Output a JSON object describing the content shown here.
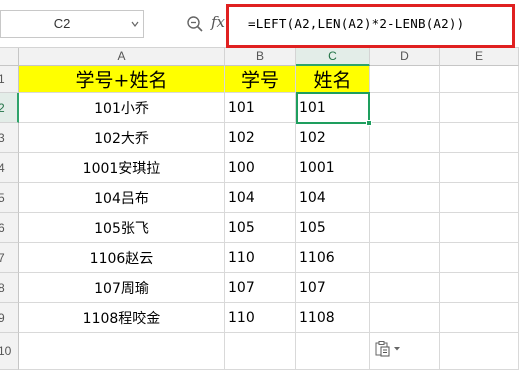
{
  "formula_bar": {
    "name_box": "C2",
    "name_box_dropdown_icon": "chevron-down-icon",
    "zoom_icon": "magnifier-icon",
    "fx_label": "fx",
    "formula": "=LEFT(A2,LEN(A2)*2-LENB(A2))",
    "highlight_color": "#e02020"
  },
  "columns": [
    "A",
    "B",
    "C",
    "D",
    "E"
  ],
  "rows": [
    "1",
    "2",
    "3",
    "4",
    "5",
    "6",
    "7",
    "8",
    "9",
    "10"
  ],
  "header_row": {
    "a": "学号+姓名",
    "b": "学号",
    "c": "姓名",
    "fill": "#ffff00"
  },
  "data_rows": [
    {
      "a": "101小乔",
      "b": "101",
      "c": "101"
    },
    {
      "a": "102大乔",
      "b": "102",
      "c": "102"
    },
    {
      "a": "1001安琪拉",
      "b": "100",
      "c": "1001"
    },
    {
      "a": "104吕布",
      "b": "104",
      "c": "104"
    },
    {
      "a": "105张飞",
      "b": "105",
      "c": "105"
    },
    {
      "a": "1106赵云",
      "b": "110",
      "c": "1106"
    },
    {
      "a": "107周瑜",
      "b": "107",
      "c": "107"
    },
    {
      "a": "1108程咬金",
      "b": "110",
      "c": "1108"
    }
  ],
  "active_cell": "C2",
  "paste_options_icon": "paste-options-icon"
}
